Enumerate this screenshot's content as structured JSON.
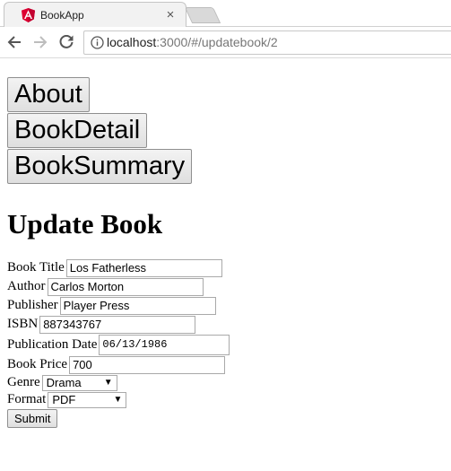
{
  "browser": {
    "tab_title": "BookApp",
    "close_glyph": "×",
    "url_host": "localhost",
    "url_path": ":3000/#/updatebook/2",
    "icons": [
      "angular-logo-icon",
      "close-icon",
      "back-icon",
      "forward-icon",
      "reload-icon",
      "info-icon"
    ]
  },
  "nav": {
    "about": "About",
    "book_detail": "BookDetail",
    "book_summary": "BookSummary"
  },
  "page": {
    "heading": "Update Book"
  },
  "form": {
    "title_label": "Book Title",
    "title_value": "Los Fatherless",
    "author_label": "Author",
    "author_value": "Carlos Morton",
    "publisher_label": "Publisher",
    "publisher_value": "Player Press",
    "isbn_label": "ISBN",
    "isbn_value": "887343767",
    "pubdate_label": "Publication Date",
    "pubdate_value": "06/13/1986",
    "price_label": "Book Price",
    "price_value": "700",
    "genre_label": "Genre",
    "genre_value": "Drama",
    "format_label": "Format",
    "format_value": "PDF",
    "caret": "▼",
    "submit_label": "Submit"
  },
  "colors": {
    "angular_red": "#dd0031"
  }
}
